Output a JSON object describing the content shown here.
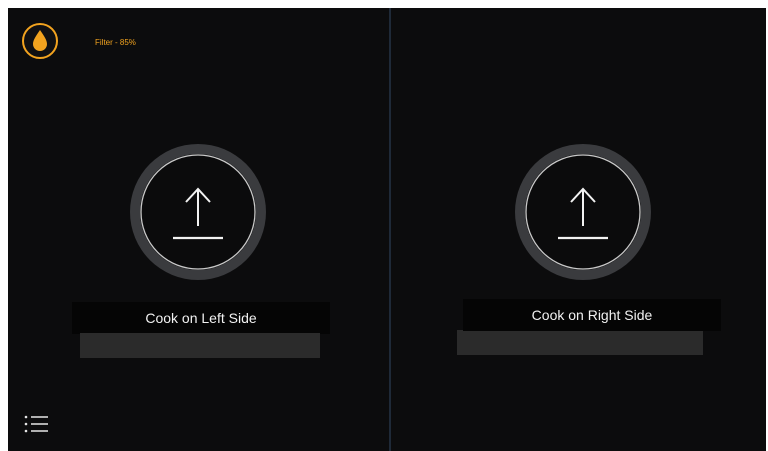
{
  "status": {
    "filter_label": "Filter - 85%",
    "filter_level_percent": 85,
    "filter_icon": "water-drop-icon",
    "accent_color": "#f2a31f"
  },
  "left_side": {
    "label": "Cook on Left Side",
    "icon": "upload-arrow-icon"
  },
  "right_side": {
    "label": "Cook on Right Side",
    "icon": "upload-arrow-icon"
  },
  "menu": {
    "icon": "list-menu-icon"
  }
}
